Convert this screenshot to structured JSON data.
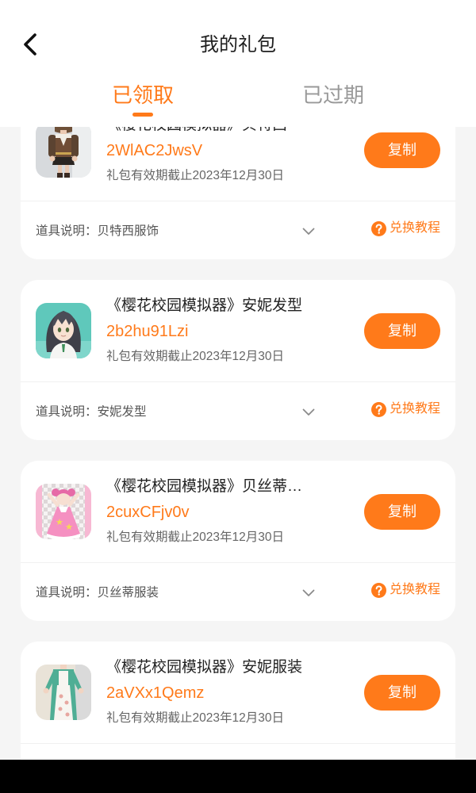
{
  "colors": {
    "accent": "#ff7a1a",
    "tab_inactive": "#999999",
    "page_bg": "#f5f5f5",
    "nav_bar": "#000000"
  },
  "header": {
    "title": "我的礼包",
    "back_icon": "back-chevron-icon"
  },
  "tabs": [
    {
      "label": "已领取",
      "active": true
    },
    {
      "label": "已过期",
      "active": false
    }
  ],
  "labels": {
    "copy": "复制",
    "help": "兑换教程",
    "desc_prefix": "道具说明：",
    "help_icon": "question-circle-icon",
    "expand_icon": "chevron-down-icon"
  },
  "gifts": [
    {
      "title": "《樱花校园模拟器》贝特西",
      "code": "2WlAC2JwsV",
      "validity": "礼包有效期截止2023年12月30日",
      "desc": "贝特西服饰"
    },
    {
      "title": "《樱花校园模拟器》安妮发型",
      "code": "2b2hu91Lzi",
      "validity": "礼包有效期截止2023年12月30日",
      "desc": "安妮发型"
    },
    {
      "title": "《樱花校园模拟器》贝丝蒂…",
      "code": "2cuxCFjv0v",
      "validity": "礼包有效期截止2023年12月30日",
      "desc": "贝丝蒂服装"
    },
    {
      "title": "《樱花校园模拟器》安妮服装",
      "code": "2aVXx1Qemz",
      "validity": "礼包有效期截止2023年12月30日"
    }
  ]
}
